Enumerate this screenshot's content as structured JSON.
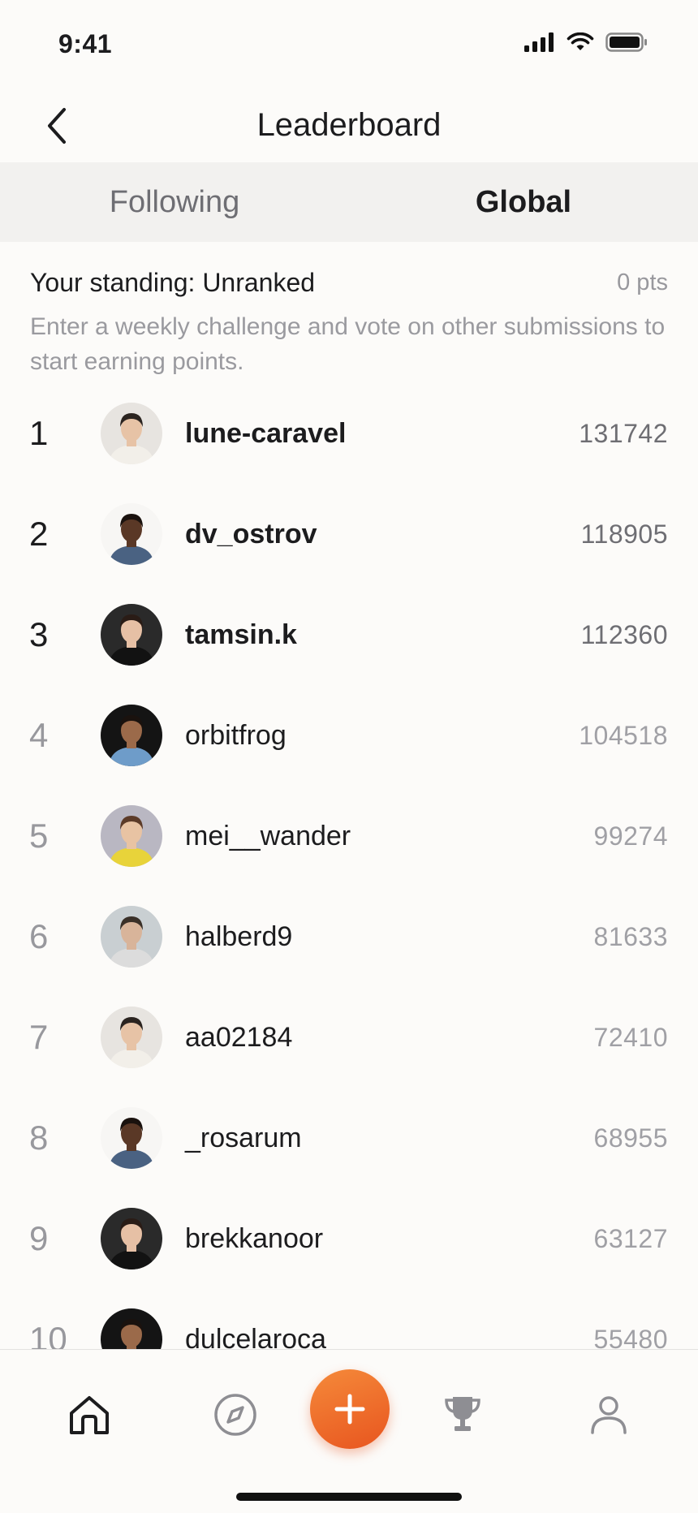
{
  "status_bar": {
    "time": "9:41"
  },
  "header": {
    "title": "Leaderboard"
  },
  "tabs": [
    {
      "label": "Following",
      "active": false
    },
    {
      "label": "Global",
      "active": true
    }
  ],
  "standing": {
    "title": "Your standing: Unranked",
    "points": "0 pts",
    "description": "Enter a weekly challenge and vote on other submissions to start earning points."
  },
  "leaderboard": [
    {
      "rank": "1",
      "username": "lune-caravel",
      "score": "131742",
      "avatar_bg": "#e7e4e0",
      "avatar_skin": "#e7c3a6",
      "avatar_hair": "#2b2420",
      "avatar_shirt": "#f2efe9"
    },
    {
      "rank": "2",
      "username": "dv_ostrov",
      "score": "118905",
      "avatar_bg": "#f7f6f4",
      "avatar_skin": "#5a3826",
      "avatar_hair": "#1a120e",
      "avatar_shirt": "#4a6282"
    },
    {
      "rank": "3",
      "username": "tamsin.k",
      "score": "112360",
      "avatar_bg": "#2a2a2a",
      "avatar_skin": "#e6c0a5",
      "avatar_hair": "#2a1c16",
      "avatar_shirt": "#121212"
    },
    {
      "rank": "4",
      "username": "orbitfrog",
      "score": "104518",
      "avatar_bg": "#141414",
      "avatar_skin": "#9b6a4a",
      "avatar_hair": "#1a120e",
      "avatar_shirt": "#6e9cc9"
    },
    {
      "rank": "5",
      "username": "mei__wander",
      "score": "99274",
      "avatar_bg": "#b9b7c2",
      "avatar_skin": "#e8c3a3",
      "avatar_hair": "#5c3b28",
      "avatar_shirt": "#e8d33a"
    },
    {
      "rank": "6",
      "username": "halberd9",
      "score": "81633",
      "avatar_bg": "#c9cfd2",
      "avatar_skin": "#d8b49a",
      "avatar_hair": "#3a3028",
      "avatar_shirt": "#dcdcdc"
    },
    {
      "rank": "7",
      "username": "aa02184",
      "score": "72410",
      "avatar_bg": "#e7e4e0",
      "avatar_skin": "#e7c3a6",
      "avatar_hair": "#2b2420",
      "avatar_shirt": "#f2efe9"
    },
    {
      "rank": "8",
      "username": "_rosarum",
      "score": "68955",
      "avatar_bg": "#f7f6f4",
      "avatar_skin": "#5a3826",
      "avatar_hair": "#1a120e",
      "avatar_shirt": "#4a6282"
    },
    {
      "rank": "9",
      "username": "brekkanoor",
      "score": "63127",
      "avatar_bg": "#2a2a2a",
      "avatar_skin": "#e6c0a5",
      "avatar_hair": "#2a1c16",
      "avatar_shirt": "#121212"
    },
    {
      "rank": "10",
      "username": "dulcelaroca",
      "score": "55480",
      "avatar_bg": "#141414",
      "avatar_skin": "#9b6a4a",
      "avatar_hair": "#1a120e",
      "avatar_shirt": "#6e9cc9"
    }
  ],
  "tab_bar": {
    "items": [
      {
        "icon": "home-icon",
        "active": true
      },
      {
        "icon": "compass-icon",
        "active": false
      },
      {
        "icon": "plus-icon",
        "active": false
      },
      {
        "icon": "trophy-icon",
        "active": false
      },
      {
        "icon": "profile-icon",
        "active": false
      }
    ],
    "accent_color": "#ef6a2a"
  }
}
